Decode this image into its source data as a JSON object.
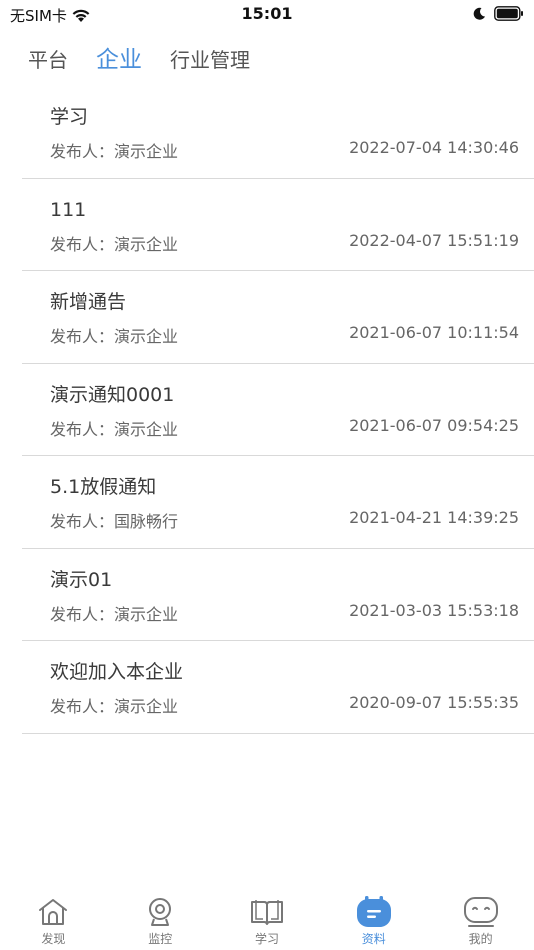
{
  "status_bar": {
    "carrier": "无SIM卡",
    "time": "15:01"
  },
  "tabs": [
    {
      "label": "平台",
      "active": false
    },
    {
      "label": "企业",
      "active": true
    },
    {
      "label": "行业管理",
      "active": false
    }
  ],
  "list": {
    "publisher_prefix": "发布人：",
    "items": [
      {
        "title": "学习",
        "publisher": "演示企业",
        "datetime": "2022-07-04 14:30:46"
      },
      {
        "title": "111",
        "publisher": "演示企业",
        "datetime": "2022-04-07 15:51:19"
      },
      {
        "title": "新增通告",
        "publisher": "演示企业",
        "datetime": "2021-06-07 10:11:54"
      },
      {
        "title": "演示通知0001",
        "publisher": "演示企业",
        "datetime": "2021-06-07 09:54:25"
      },
      {
        "title": "5.1放假通知",
        "publisher": "国脉畅行",
        "datetime": "2021-04-21 14:39:25"
      },
      {
        "title": "演示01",
        "publisher": "演示企业",
        "datetime": "2021-03-03 15:53:18"
      },
      {
        "title": "欢迎加入本企业",
        "publisher": "演示企业",
        "datetime": "2020-09-07 15:55:35"
      }
    ]
  },
  "bottom_nav": [
    {
      "label": "发现",
      "icon": "home-icon",
      "active": false
    },
    {
      "label": "监控",
      "icon": "camera-icon",
      "active": false
    },
    {
      "label": "学习",
      "icon": "book-icon",
      "active": false
    },
    {
      "label": "资料",
      "icon": "document-icon",
      "active": true
    },
    {
      "label": "我的",
      "icon": "face-icon",
      "active": false
    }
  ],
  "colors": {
    "accent": "#4a8fdb",
    "text": "#3a3a3a",
    "muted": "#666666",
    "divider": "#d9d9d9"
  }
}
